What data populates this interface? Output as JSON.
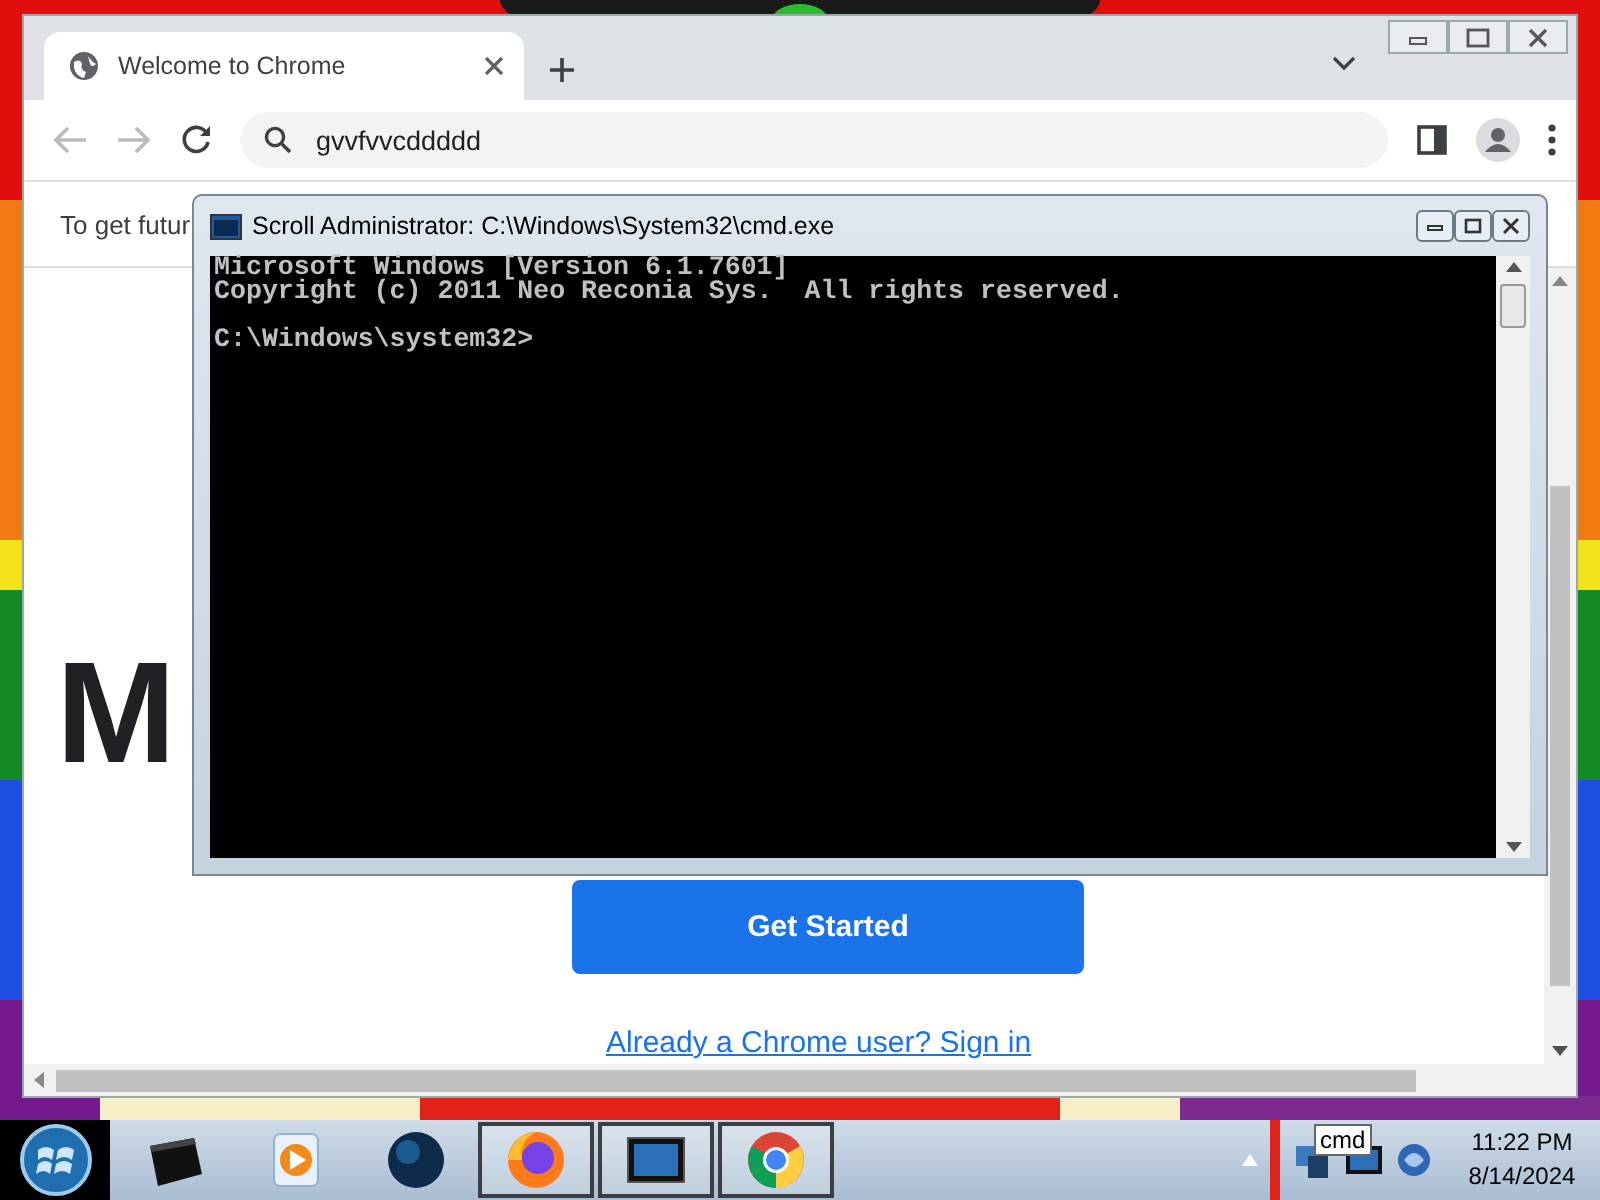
{
  "chrome": {
    "tabs": [
      {
        "title": "Welcome to Chrome",
        "selected": true
      }
    ],
    "address": "gvvfvvcddddd",
    "infobar": "To get futur",
    "heading": "M",
    "primary_button": "Get Started",
    "link": "Already a Chrome user? Sign in"
  },
  "cmd": {
    "title": "Scroll Administrator: C:\\Windows\\System32\\cmd.exe",
    "lines": [
      "Microsoft Windows [Version 6.1.7601]",
      "Copyright (c) 2011 Neo Reconia Sys.  All rights reserved."
    ],
    "prompt": "C:\\Windows\\system32>"
  },
  "taskbar": {
    "apps": [
      {
        "kind": "explorer",
        "open": false
      },
      {
        "kind": "media",
        "open": false
      },
      {
        "kind": "globe",
        "open": false
      },
      {
        "kind": "firefox",
        "open": true
      },
      {
        "kind": "cmd",
        "open": true
      },
      {
        "kind": "chrome",
        "open": true
      }
    ],
    "tooltip": "cmd",
    "time": "11:22 PM",
    "date": "8/14/2024"
  }
}
